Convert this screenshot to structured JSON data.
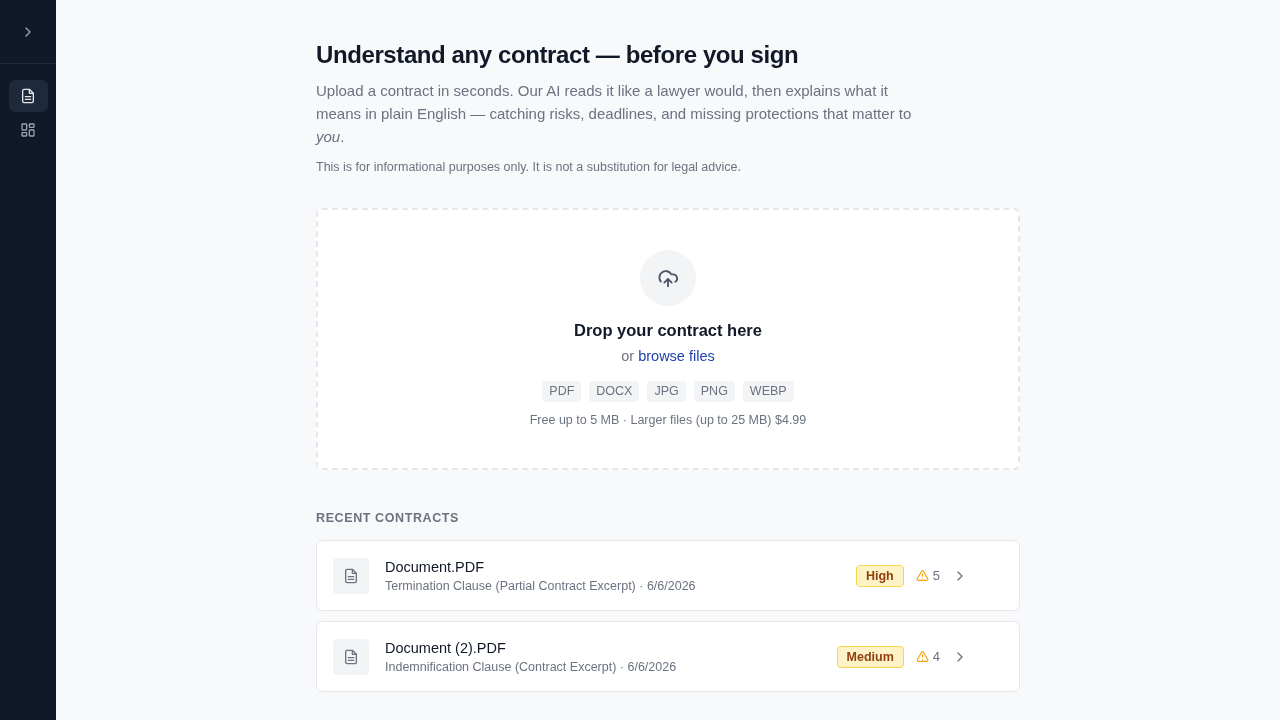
{
  "sidebar": {
    "toggle": {
      "expanded": false
    },
    "items": [
      {
        "kind": "document",
        "selected": true
      },
      {
        "kind": "grid",
        "selected": false
      }
    ]
  },
  "header": {
    "title": "Understand any contract — before you sign",
    "intro": "Upload a contract in seconds. Our AI reads it like a lawyer would, then explains what it means in plain English — catching risks, deadlines, and missing protections that matter to *you*.",
    "disclaimer": "This is for informational purposes only. It is not a substitution for legal advice."
  },
  "upload": {
    "title": "Drop your contract here",
    "prefix": "or",
    "link": "browse files",
    "formats": [
      "PDF",
      "DOCX",
      "JPG",
      "PNG",
      "WEBP"
    ],
    "note": "Free up to 5 MB · Larger files (up to 25 MB) $4.99"
  },
  "recent": {
    "heading": "RECENT CONTRACTS",
    "items": [
      {
        "name": "Document.PDF",
        "detail": "Termination Clause (Partial Contract Excerpt) · 6/6/2026",
        "risk": "High",
        "issues": "5"
      },
      {
        "name": "Document (2).PDF",
        "detail": "Indemnification Clause (Contract Excerpt) · 6/6/2026",
        "risk": "Medium",
        "issues": "4"
      }
    ]
  }
}
